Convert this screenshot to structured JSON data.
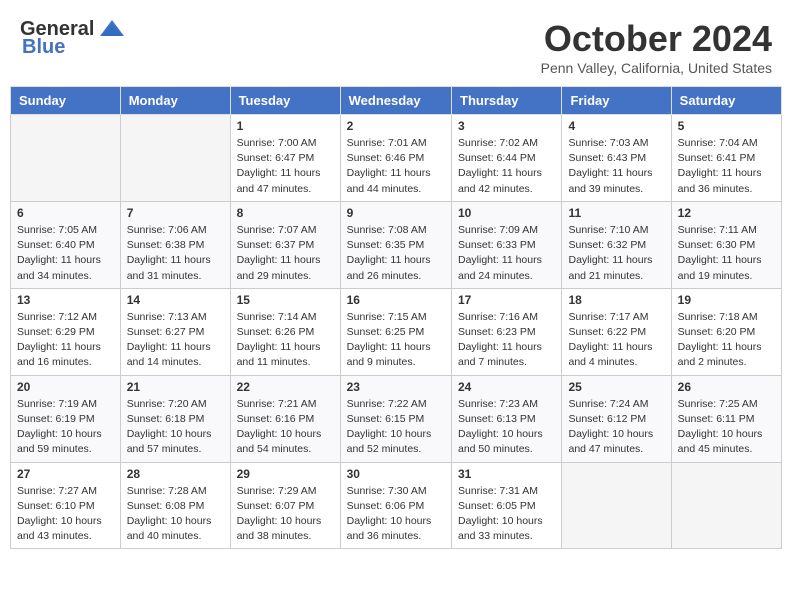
{
  "header": {
    "logo_line1": "General",
    "logo_line2": "Blue",
    "month": "October 2024",
    "location": "Penn Valley, California, United States"
  },
  "days_of_week": [
    "Sunday",
    "Monday",
    "Tuesday",
    "Wednesday",
    "Thursday",
    "Friday",
    "Saturday"
  ],
  "weeks": [
    [
      {
        "day": "",
        "info": ""
      },
      {
        "day": "",
        "info": ""
      },
      {
        "day": "1",
        "info": "Sunrise: 7:00 AM\nSunset: 6:47 PM\nDaylight: 11 hours and 47 minutes."
      },
      {
        "day": "2",
        "info": "Sunrise: 7:01 AM\nSunset: 6:46 PM\nDaylight: 11 hours and 44 minutes."
      },
      {
        "day": "3",
        "info": "Sunrise: 7:02 AM\nSunset: 6:44 PM\nDaylight: 11 hours and 42 minutes."
      },
      {
        "day": "4",
        "info": "Sunrise: 7:03 AM\nSunset: 6:43 PM\nDaylight: 11 hours and 39 minutes."
      },
      {
        "day": "5",
        "info": "Sunrise: 7:04 AM\nSunset: 6:41 PM\nDaylight: 11 hours and 36 minutes."
      }
    ],
    [
      {
        "day": "6",
        "info": "Sunrise: 7:05 AM\nSunset: 6:40 PM\nDaylight: 11 hours and 34 minutes."
      },
      {
        "day": "7",
        "info": "Sunrise: 7:06 AM\nSunset: 6:38 PM\nDaylight: 11 hours and 31 minutes."
      },
      {
        "day": "8",
        "info": "Sunrise: 7:07 AM\nSunset: 6:37 PM\nDaylight: 11 hours and 29 minutes."
      },
      {
        "day": "9",
        "info": "Sunrise: 7:08 AM\nSunset: 6:35 PM\nDaylight: 11 hours and 26 minutes."
      },
      {
        "day": "10",
        "info": "Sunrise: 7:09 AM\nSunset: 6:33 PM\nDaylight: 11 hours and 24 minutes."
      },
      {
        "day": "11",
        "info": "Sunrise: 7:10 AM\nSunset: 6:32 PM\nDaylight: 11 hours and 21 minutes."
      },
      {
        "day": "12",
        "info": "Sunrise: 7:11 AM\nSunset: 6:30 PM\nDaylight: 11 hours and 19 minutes."
      }
    ],
    [
      {
        "day": "13",
        "info": "Sunrise: 7:12 AM\nSunset: 6:29 PM\nDaylight: 11 hours and 16 minutes."
      },
      {
        "day": "14",
        "info": "Sunrise: 7:13 AM\nSunset: 6:27 PM\nDaylight: 11 hours and 14 minutes."
      },
      {
        "day": "15",
        "info": "Sunrise: 7:14 AM\nSunset: 6:26 PM\nDaylight: 11 hours and 11 minutes."
      },
      {
        "day": "16",
        "info": "Sunrise: 7:15 AM\nSunset: 6:25 PM\nDaylight: 11 hours and 9 minutes."
      },
      {
        "day": "17",
        "info": "Sunrise: 7:16 AM\nSunset: 6:23 PM\nDaylight: 11 hours and 7 minutes."
      },
      {
        "day": "18",
        "info": "Sunrise: 7:17 AM\nSunset: 6:22 PM\nDaylight: 11 hours and 4 minutes."
      },
      {
        "day": "19",
        "info": "Sunrise: 7:18 AM\nSunset: 6:20 PM\nDaylight: 11 hours and 2 minutes."
      }
    ],
    [
      {
        "day": "20",
        "info": "Sunrise: 7:19 AM\nSunset: 6:19 PM\nDaylight: 10 hours and 59 minutes."
      },
      {
        "day": "21",
        "info": "Sunrise: 7:20 AM\nSunset: 6:18 PM\nDaylight: 10 hours and 57 minutes."
      },
      {
        "day": "22",
        "info": "Sunrise: 7:21 AM\nSunset: 6:16 PM\nDaylight: 10 hours and 54 minutes."
      },
      {
        "day": "23",
        "info": "Sunrise: 7:22 AM\nSunset: 6:15 PM\nDaylight: 10 hours and 52 minutes."
      },
      {
        "day": "24",
        "info": "Sunrise: 7:23 AM\nSunset: 6:13 PM\nDaylight: 10 hours and 50 minutes."
      },
      {
        "day": "25",
        "info": "Sunrise: 7:24 AM\nSunset: 6:12 PM\nDaylight: 10 hours and 47 minutes."
      },
      {
        "day": "26",
        "info": "Sunrise: 7:25 AM\nSunset: 6:11 PM\nDaylight: 10 hours and 45 minutes."
      }
    ],
    [
      {
        "day": "27",
        "info": "Sunrise: 7:27 AM\nSunset: 6:10 PM\nDaylight: 10 hours and 43 minutes."
      },
      {
        "day": "28",
        "info": "Sunrise: 7:28 AM\nSunset: 6:08 PM\nDaylight: 10 hours and 40 minutes."
      },
      {
        "day": "29",
        "info": "Sunrise: 7:29 AM\nSunset: 6:07 PM\nDaylight: 10 hours and 38 minutes."
      },
      {
        "day": "30",
        "info": "Sunrise: 7:30 AM\nSunset: 6:06 PM\nDaylight: 10 hours and 36 minutes."
      },
      {
        "day": "31",
        "info": "Sunrise: 7:31 AM\nSunset: 6:05 PM\nDaylight: 10 hours and 33 minutes."
      },
      {
        "day": "",
        "info": ""
      },
      {
        "day": "",
        "info": ""
      }
    ]
  ]
}
